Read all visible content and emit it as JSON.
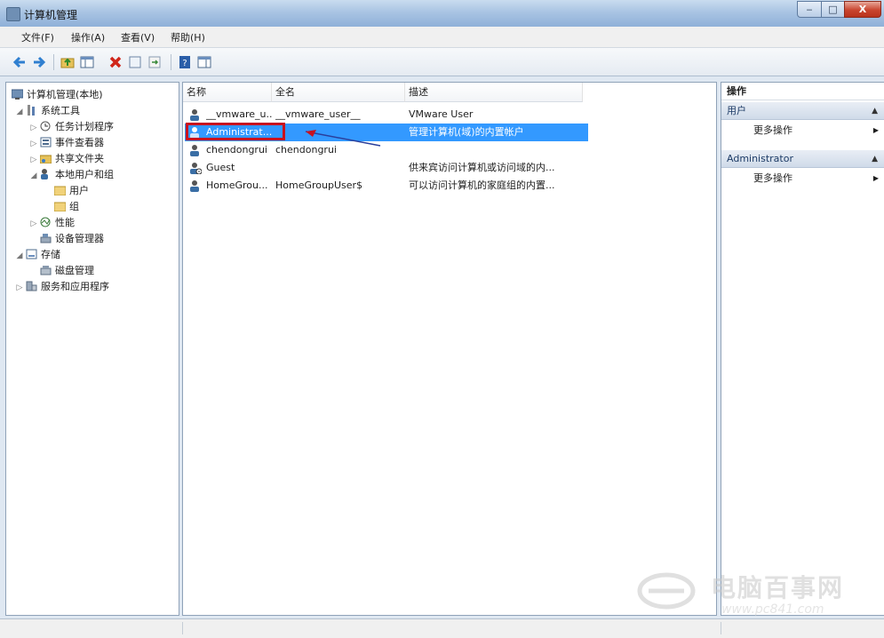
{
  "window": {
    "title": "计算机管理",
    "close_glyph": "X"
  },
  "menu": {
    "items": [
      "文件(F)",
      "操作(A)",
      "查看(V)",
      "帮助(H)"
    ]
  },
  "tree": {
    "root": "计算机管理(本地)",
    "items": [
      {
        "label": "系统工具"
      },
      {
        "label": "任务计划程序"
      },
      {
        "label": "事件查看器"
      },
      {
        "label": "共享文件夹"
      },
      {
        "label": "本地用户和组"
      },
      {
        "label": "用户"
      },
      {
        "label": "组"
      },
      {
        "label": "性能"
      },
      {
        "label": "设备管理器"
      },
      {
        "label": "存储"
      },
      {
        "label": "磁盘管理"
      },
      {
        "label": "服务和应用程序"
      }
    ]
  },
  "list": {
    "columns": [
      "名称",
      "全名",
      "描述"
    ],
    "rows": [
      {
        "name": "__vmware_u...",
        "full": "__vmware_user__",
        "desc": "VMware User",
        "selected": false
      },
      {
        "name": "Administrat...",
        "full": "",
        "desc": "管理计算机(域)的内置帐户",
        "selected": true
      },
      {
        "name": "chendongrui",
        "full": "chendongrui",
        "desc": "",
        "selected": false
      },
      {
        "name": "Guest",
        "full": "",
        "desc": "供来宾访问计算机或访问域的内...",
        "selected": false
      },
      {
        "name": "HomeGrou...",
        "full": "HomeGroupUser$",
        "desc": "可以访问计算机的家庭组的内置...",
        "selected": false
      }
    ],
    "highlight_color": "#c8121e",
    "selection_color": "#3399ff"
  },
  "actions": {
    "header": "操作",
    "sections": [
      {
        "title": "用户",
        "item": "更多操作"
      },
      {
        "title": "Administrator",
        "item": "更多操作"
      }
    ]
  },
  "watermark": {
    "text": "电脑百事网",
    "url": "www.pc841.com"
  }
}
